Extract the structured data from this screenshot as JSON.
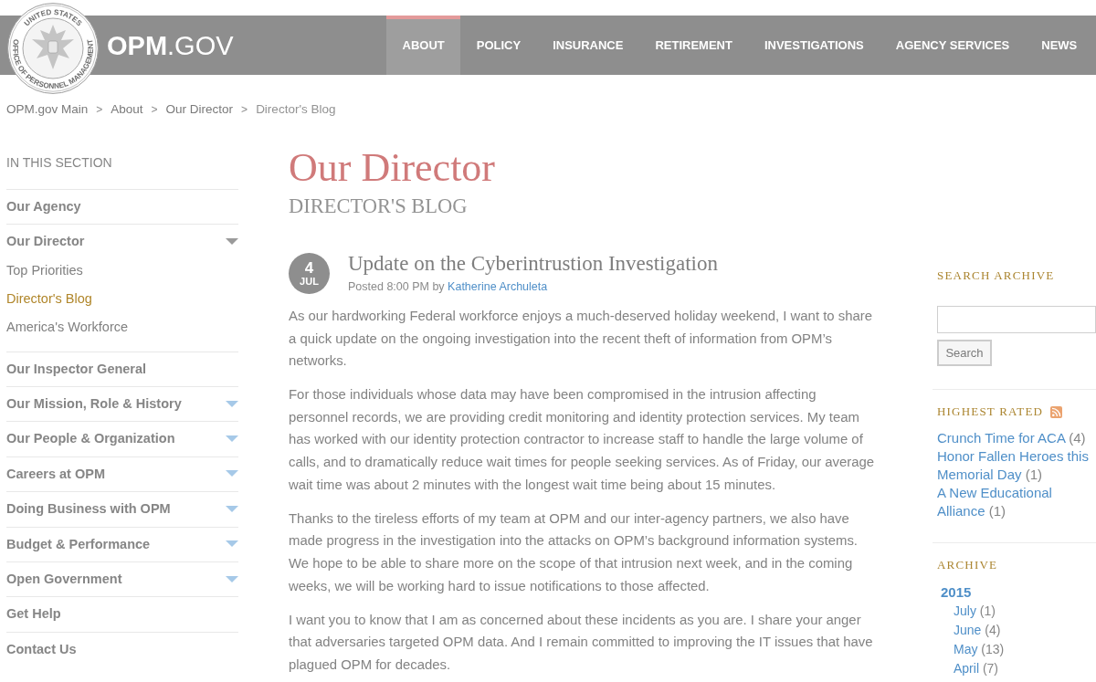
{
  "header": {
    "seal_top": "UNITED STATES",
    "seal_bottom": "OFFICE OF PERSONNEL MANAGEMENT",
    "logo": "**OPM**.GOV",
    "nav": [
      {
        "label": "ABOUT",
        "selected": true
      },
      {
        "label": "POLICY",
        "selected": false
      },
      {
        "label": "INSURANCE",
        "selected": false
      },
      {
        "label": "RETIREMENT",
        "selected": false
      },
      {
        "label": "INVESTIGATIONS",
        "selected": false
      },
      {
        "label": "AGENCY SERVICES",
        "selected": false
      },
      {
        "label": "NEWS",
        "selected": false
      }
    ]
  },
  "breadcrumb": [
    {
      "label": "OPM.gov Main",
      "current": false
    },
    {
      "separator": ">",
      "label": "About",
      "current": false
    },
    {
      "separator": ">",
      "label": "Our Director",
      "current": false
    },
    {
      "separator": ">",
      "label": "Director's Blog",
      "current": true
    }
  ],
  "sidebar": {
    "heading": "IN THIS SECTION",
    "items": [
      {
        "kind": "link",
        "label": "Our Agency"
      },
      {
        "kind": "group",
        "label": "Our Director",
        "expanded": true,
        "children": [
          {
            "label": "Top Priorities",
            "selected": false
          },
          {
            "label": "Director's Blog",
            "selected": true
          },
          {
            "label": "America's Workforce",
            "selected": false
          }
        ]
      },
      {
        "kind": "link",
        "label": "Our Inspector General"
      },
      {
        "kind": "group",
        "label": "Our Mission, Role & History",
        "expanded": false
      },
      {
        "kind": "group",
        "label": "Our People & Organization",
        "expanded": false
      },
      {
        "kind": "group",
        "label": "Careers at OPM",
        "expanded": false
      },
      {
        "kind": "group",
        "label": "Doing Business with OPM",
        "expanded": false
      },
      {
        "kind": "group",
        "label": "Budget & Performance",
        "expanded": false
      },
      {
        "kind": "group",
        "label": "Open Government",
        "expanded": false
      },
      {
        "kind": "link",
        "label": "Get Help"
      },
      {
        "kind": "link",
        "label": "Contact Us"
      }
    ]
  },
  "main": {
    "title": "Our Director",
    "subtitle": "DIRECTOR'S BLOG",
    "post": {
      "day": "4",
      "month": "JUL",
      "title": "Update on the Cyberintrustion Investigation",
      "posted": "Posted 8:00 PM by",
      "author": "Katherine Archuleta",
      "paragraphs": [
        "As our hardworking Federal workforce enjoys a much-deserved holiday weekend, I want to share a quick update on the ongoing investigation into the recent theft of information from OPM’s networks.",
        "For those individuals whose data may have been compromised in the intrusion affecting personnel records, we are providing credit monitoring and identity protection services. My team has worked with our identity protection contractor to increase staff to handle the large volume of calls, and to dramatically reduce wait times for people seeking services. As of Friday, our average wait time was about 2 minutes with the longest wait time being about 15 minutes.",
        "Thanks to the tireless efforts of my team at OPM and our inter-agency partners, we also have made progress in the investigation into the attacks on OPM’s background information systems. We hope to be able to share more on the scope of that intrusion next week, and in the coming weeks, we will be working hard to issue notifications to those affected.",
        "I want you to know that I am as concerned about these incidents as you are. I share your anger that adversaries targeted OPM data. And I remain committed to improving the IT issues that have plagued OPM for decades."
      ]
    }
  },
  "right_column": {
    "search": {
      "heading": "SEARCH ARCHIVE",
      "button": "Search"
    },
    "highest_rated": {
      "heading": "HIGHEST RATED",
      "items": [
        {
          "title": "Crunch Time for ACA",
          "count": "(4)"
        },
        {
          "title": "Honor Fallen Heroes this Memorial Day",
          "count": "(1)"
        },
        {
          "title": "A New Educational Alliance",
          "count": "(1)"
        }
      ]
    },
    "archive": {
      "heading": "ARCHIVE",
      "years": [
        {
          "label": "2015",
          "children": [
            {
              "label": "July",
              "count": "(1)"
            },
            {
              "label": "June",
              "count": "(4)"
            },
            {
              "label": "May",
              "count": "(13)"
            },
            {
              "label": "April",
              "count": "(7)"
            }
          ]
        }
      ]
    }
  }
}
